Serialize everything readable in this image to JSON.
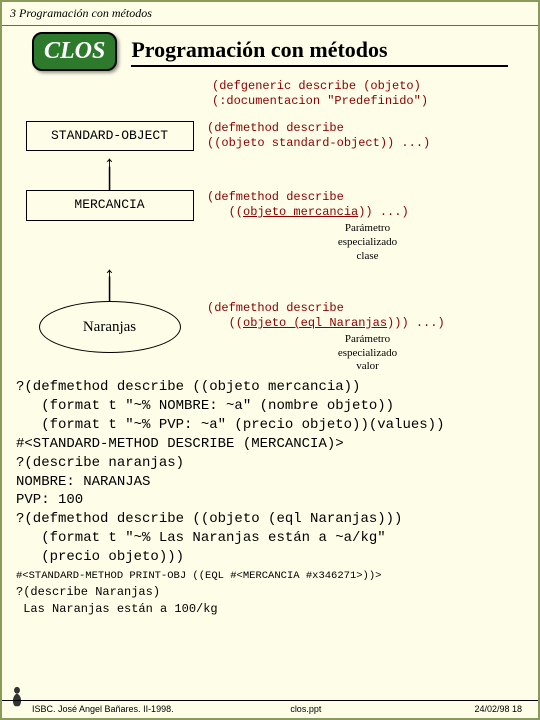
{
  "topbar": "3 Programación con métodos",
  "badge": "CLOS",
  "title": "Programación con métodos",
  "defgeneric_l1": "(defgeneric describe (objeto)",
  "defgeneric_l2": "   (:documentacion \"Predefinido\")",
  "box_std": "STANDARD-OBJECT",
  "method_std_l1": "(defmethod describe",
  "method_std_l2": "   ((objeto standard-object)) ...)",
  "box_merc": "MERCANCIA",
  "method_merc_l1": "(defmethod describe",
  "method_merc_uline": "objeto mercancia",
  "method_merc_tail": ")) ...)",
  "note_class_l1": "Parámetro",
  "note_class_l2": "especializado",
  "note_class_l3": "clase",
  "ellipse_label": "Naranjas",
  "method_nar_l1": "(defmethod describe",
  "method_nar_uline": "objeto (eql Naranjas",
  "method_nar_tail": "))) ...)",
  "note_val_l1": "Parámetro",
  "note_val_l2": "especializado",
  "note_val_l3": "valor",
  "ex01": "?(defmethod describe ((objeto mercancia))",
  "ex02": "   (format t \"~% NOMBRE: ~a\" (nombre objeto))",
  "ex03": "   (format t \"~% PVP: ~a\" (precio objeto))(values))",
  "ex04": "#<STANDARD-METHOD DESCRIBE (MERCANCIA)>",
  "ex05": "?(describe naranjas)",
  "ex06": "NOMBRE: NARANJAS",
  "ex07": "PVP: 100",
  "ex08": "?(defmethod describe ((objeto (eql Naranjas)))",
  "ex09": "   (format t \"~% Las Naranjas están a ~a/kg\"",
  "ex10": "   (precio objeto)))",
  "ex11": "#<STANDARD-METHOD PRINT-OBJ ((EQL #<MERCANCIA #x346271>))>",
  "ex12": "?(describe Naranjas)",
  "ex13": " Las Naranjas están a 100/kg",
  "footer_left": "ISBC. José Angel Bañares. II-1998.",
  "footer_mid": "clos.ppt",
  "footer_right": "24/02/98  18"
}
